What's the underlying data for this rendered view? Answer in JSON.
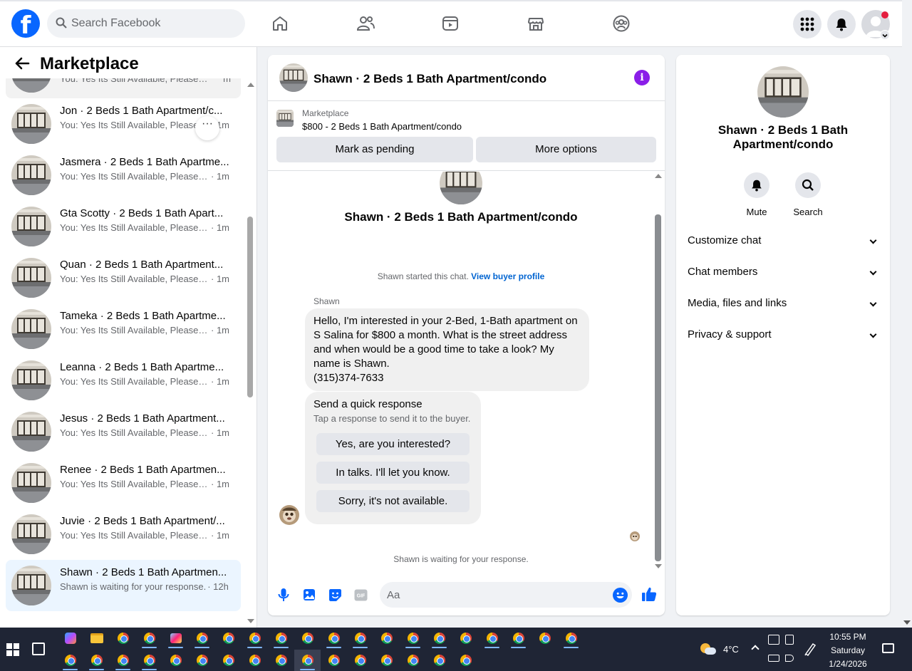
{
  "topbar": {
    "logo": "f",
    "search_placeholder": "Search Facebook",
    "nav": [
      "home-icon",
      "friends-icon",
      "watch-icon",
      "marketplace-icon",
      "groups-icon"
    ],
    "right": [
      "menu-grid-icon",
      "notifications-bell-icon",
      "profile-avatar"
    ]
  },
  "sidebar": {
    "title": "Marketplace",
    "first_partial": {
      "preview": "You: Yes Its Still Available, Please S...",
      "time": "m"
    },
    "conversations": [
      {
        "name": "Jon · 2 Beds 1 Bath Apartment/c...",
        "preview": "You: Yes Its Still Available, Please S...",
        "time": "· 1m"
      },
      {
        "name": "Jasmera · 2 Beds 1 Bath Apartme...",
        "preview": "You: Yes Its Still Available, Please S...",
        "time": "· 1m"
      },
      {
        "name": "Gta Scotty · 2 Beds 1 Bath Apart...",
        "preview": "You: Yes Its Still Available, Please S...",
        "time": "· 1m"
      },
      {
        "name": "Quan · 2 Beds 1 Bath Apartment...",
        "preview": "You: Yes Its Still Available, Please S...",
        "time": "· 1m"
      },
      {
        "name": "Tameka · 2 Beds 1 Bath Apartme...",
        "preview": "You: Yes Its Still Available, Please S...",
        "time": "· 1m"
      },
      {
        "name": "Leanna · 2 Beds 1 Bath Apartme...",
        "preview": "You: Yes Its Still Available, Please S...",
        "time": "· 1m"
      },
      {
        "name": "Jesus · 2 Beds 1 Bath Apartment...",
        "preview": "You: Yes Its Still Available, Please S...",
        "time": "· 1m"
      },
      {
        "name": "Renee · 2 Beds 1 Bath Apartmen...",
        "preview": "You: Yes Its Still Available, Please S...",
        "time": "· 1m"
      },
      {
        "name": "Juvie · 2 Beds 1 Bath Apartment/...",
        "preview": "You: Yes Its Still Available, Please S...",
        "time": "· 1m"
      },
      {
        "name": "Shawn · 2 Beds 1 Bath Apartmen...",
        "preview": "Shawn is waiting for your response.",
        "time": "· 12h",
        "active": true
      }
    ],
    "more_label": "···"
  },
  "chat": {
    "title": "Shawn · 2 Beds 1 Bath Apartment/condo",
    "info_label": "i",
    "listing_source": "Marketplace",
    "listing_price": "$800 - 2 Beds 1 Bath Apartment/condo",
    "mark_pending": "Mark as pending",
    "more_options": "More options",
    "thread_title": "Shawn · 2 Beds 1 Bath Apartment/condo",
    "started_text": "Shawn started this chat.",
    "view_profile": "View buyer profile",
    "sender": "Shawn",
    "message": "Hello, I'm interested in your 2-Bed, 1-Bath apartment on S Salina for $800 a month. What is the street address and when would be a good time to take a look? My name is Shawn.",
    "phone": "(315)374-7633",
    "quick_title": "Send a quick response",
    "quick_sub": "Tap a response to send it to the buyer.",
    "quick_options": [
      "Yes, are you interested?",
      "In talks. I'll let you know.",
      "Sorry, it's not available."
    ],
    "waiting": "Shawn is waiting for your response.",
    "composer_placeholder": "Aa",
    "composer_icons": [
      "microphone-icon",
      "image-icon",
      "sticker-icon",
      "gif-icon",
      "emoji-icon",
      "like-icon"
    ],
    "gif_label": "GIF"
  },
  "info_panel": {
    "title": "Shawn · 2 Beds 1 Bath Apartment/condo",
    "actions": [
      {
        "label": "Mute",
        "icon": "bell-icon"
      },
      {
        "label": "Search",
        "icon": "search-icon"
      }
    ],
    "sections": [
      "Customize chat",
      "Chat members",
      "Media, files and links",
      "Privacy & support"
    ]
  },
  "taskbar": {
    "weather": "4°C",
    "time": "10:55 PM",
    "day": "Saturday",
    "date": "1/24/2026"
  },
  "colors": {
    "brand": "#0866ff",
    "info_purple": "#8a1ee8",
    "active_item": "#ebf5ff"
  }
}
